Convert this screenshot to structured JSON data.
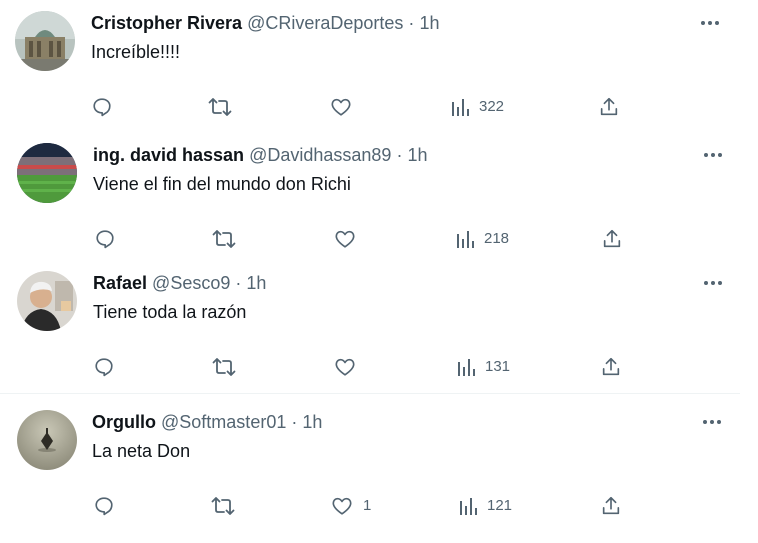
{
  "tweets": [
    {
      "name": "Cristopher Rivera",
      "handle": "@CRiveraDeportes",
      "separator": "·",
      "time": "1h",
      "text": "Increíble!!!!",
      "likes": "",
      "views": "322",
      "avatar_icon": "palace-building-avatar"
    },
    {
      "name": "ing. david hassan",
      "handle": "@Davidhassan89",
      "separator": "·",
      "time": "1h",
      "text": "Viene el fin del mundo don Richi",
      "likes": "",
      "views": "218",
      "avatar_icon": "stadium-avatar"
    },
    {
      "name": "Rafael",
      "handle": "@Sesco9",
      "separator": "·",
      "time": "1h",
      "text": "Tiene toda la razón",
      "likes": "",
      "views": "131",
      "avatar_icon": "person-avatar"
    },
    {
      "name": "Orgullo",
      "handle": "@Softmaster01",
      "separator": "·",
      "time": "1h",
      "text": "La neta Don",
      "likes": "1",
      "views": "121",
      "avatar_icon": "spinning-top-avatar"
    }
  ],
  "colors": {
    "text": "#0f1419",
    "secondary": "#536471",
    "divider": "#eff3f4",
    "background": "#ffffff"
  }
}
